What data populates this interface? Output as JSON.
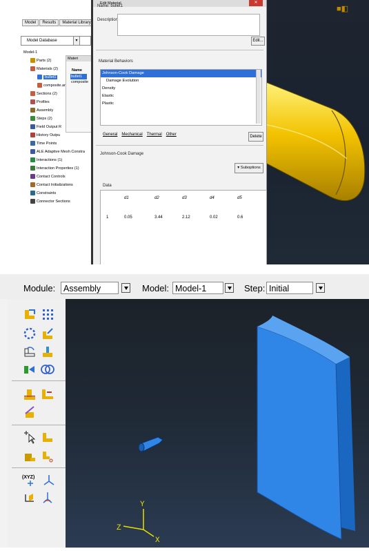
{
  "top_panel": {
    "tabs": [
      "Model",
      "Results",
      "Material Library"
    ],
    "model_database": "Model Database",
    "tree": [
      {
        "label": "Model-1",
        "indent": 0
      },
      {
        "label": "Parts (2)",
        "indent": 1
      },
      {
        "label": "Materials (2)",
        "indent": 1
      },
      {
        "label": "bullet1",
        "indent": 2,
        "selected": true
      },
      {
        "label": "composite.arm",
        "indent": 2
      },
      {
        "label": "Sections (2)",
        "indent": 1
      },
      {
        "label": "Profiles",
        "indent": 1
      },
      {
        "label": "Assembly",
        "indent": 1
      },
      {
        "label": "Steps (2)",
        "indent": 1
      },
      {
        "label": "Field Output R",
        "indent": 1
      },
      {
        "label": "History Outpu",
        "indent": 1
      },
      {
        "label": "Time Points",
        "indent": 1
      },
      {
        "label": "ALE Adaptive Mesh Constra",
        "indent": 1
      },
      {
        "label": "Interactions (1)",
        "indent": 1
      },
      {
        "label": "Interaction Properties (1)",
        "indent": 1
      },
      {
        "label": "Contact Controls",
        "indent": 1
      },
      {
        "label": "Contact Initializations",
        "indent": 1
      },
      {
        "label": "Constraints",
        "indent": 1
      },
      {
        "label": "Connector Sections",
        "indent": 1
      }
    ],
    "mini_manager": {
      "title": "Materi",
      "col": "Name",
      "rows": [
        "bullet1",
        "composite"
      ]
    },
    "dialog": {
      "title": "Edit Material",
      "name_label": "Name:",
      "name_value": "bullet1",
      "description_label": "Description:",
      "edit_button": "Edit...",
      "behaviors_label": "Material Behaviors",
      "behaviors": [
        "Johnson-Cook Damage",
        "Damage Evolution",
        "Density",
        "Elastic",
        "Plastic"
      ],
      "menus": [
        "General",
        "Mechanical",
        "Thermal",
        "Other"
      ],
      "delete_button": "Delete",
      "section_title": "Johnson-Cook Damage",
      "suboptions_button": "Suboptions",
      "data_label": "Data",
      "columns": [
        "d1",
        "d2",
        "d3",
        "d4",
        "d5"
      ],
      "rows": [
        {
          "index": "1",
          "values": [
            "0.05",
            "3.44",
            "2.12",
            "0.02",
            "0.6"
          ]
        }
      ]
    }
  },
  "bottom_panel": {
    "module_label": "Module:",
    "module_value": "Assembly",
    "model_label": "Model:",
    "model_value": "Model-1",
    "step_label": "Step:",
    "step_value": "Initial",
    "triad": {
      "y": "Y",
      "x": "X",
      "z": "Z"
    },
    "xyz_tool_label": "(XYZ)"
  },
  "colors": {
    "bullet_yellow": "#f2c200",
    "plate_blue": "#2f86e6",
    "selection_blue": "#2f6fd8",
    "triad_yellow": "#e8e000"
  }
}
